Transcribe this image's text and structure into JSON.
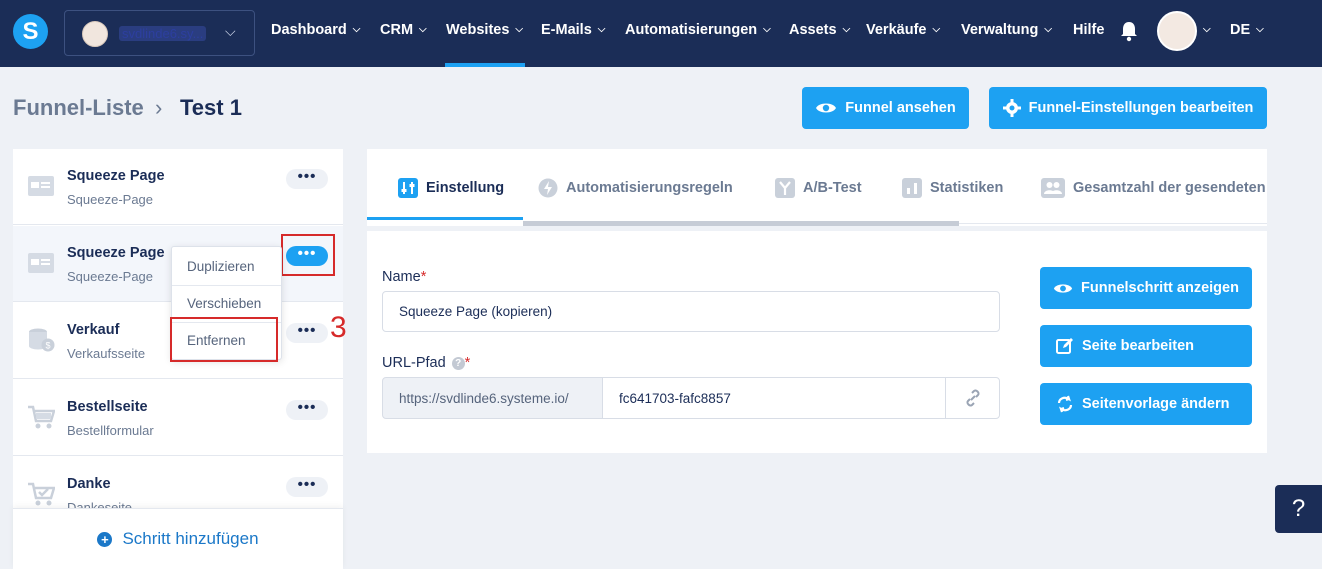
{
  "nav": {
    "logo": "S",
    "account_name": "svdlinde6.sy...",
    "items": [
      {
        "label": "Dashboard"
      },
      {
        "label": "CRM"
      },
      {
        "label": "Websites"
      },
      {
        "label": "E-Mails"
      },
      {
        "label": "Automatisierungen"
      },
      {
        "label": "Assets"
      },
      {
        "label": "Verkäufe"
      },
      {
        "label": "Verwaltung"
      }
    ],
    "help": "Hilfe",
    "language": "DE",
    "active_item": "Websites"
  },
  "breadcrumb": {
    "parent": "Funnel-Liste",
    "separator": "›",
    "current": "Test 1"
  },
  "header_buttons": {
    "view_funnel": "Funnel ansehen",
    "edit_settings": "Funnel-Einstellungen bearbeiten"
  },
  "steps": [
    {
      "title": "Squeeze Page",
      "subtitle": "Squeeze-Page",
      "icon": "page-icon"
    },
    {
      "title": "Squeeze Page",
      "subtitle": "Squeeze-Page",
      "icon": "page-icon"
    },
    {
      "title": "Verkauf",
      "subtitle": "Verkaufsseite",
      "icon": "coins-icon"
    },
    {
      "title": "Bestellseite",
      "subtitle": "Bestellformular",
      "icon": "cart-icon"
    },
    {
      "title": "Danke",
      "subtitle": "Dankeseite",
      "icon": "cart-check-icon"
    }
  ],
  "more_label": "•••",
  "context_menu": {
    "duplicate": "Duplizieren",
    "move": "Verschieben",
    "remove": "Entfernen"
  },
  "annotation": "3",
  "add_step": "Schritt hinzufügen",
  "tabs": [
    {
      "label": "Einstellung"
    },
    {
      "label": "Automatisierungsregeln"
    },
    {
      "label": "A/B-Test"
    },
    {
      "label": "Statistiken"
    },
    {
      "label": "Gesamtzahl der gesendeten"
    }
  ],
  "form": {
    "name_label": "Name",
    "name_value": "Squeeze Page (kopieren)",
    "url_label": "URL-Pfad",
    "url_prefix": "https://svdlinde6.systeme.io/",
    "url_value": "fc641703-fafc8857",
    "required_mark": "*",
    "help_mark": "?"
  },
  "side_buttons": {
    "view_step": "Funnelschritt anzeigen",
    "edit_page": "Seite bearbeiten",
    "change_template": "Seitenvorlage ändern"
  },
  "help_widget": "?",
  "colors": {
    "nav_bg": "#1b2d57",
    "accent": "#1da1f2",
    "annotation_red": "#d62a2a"
  }
}
